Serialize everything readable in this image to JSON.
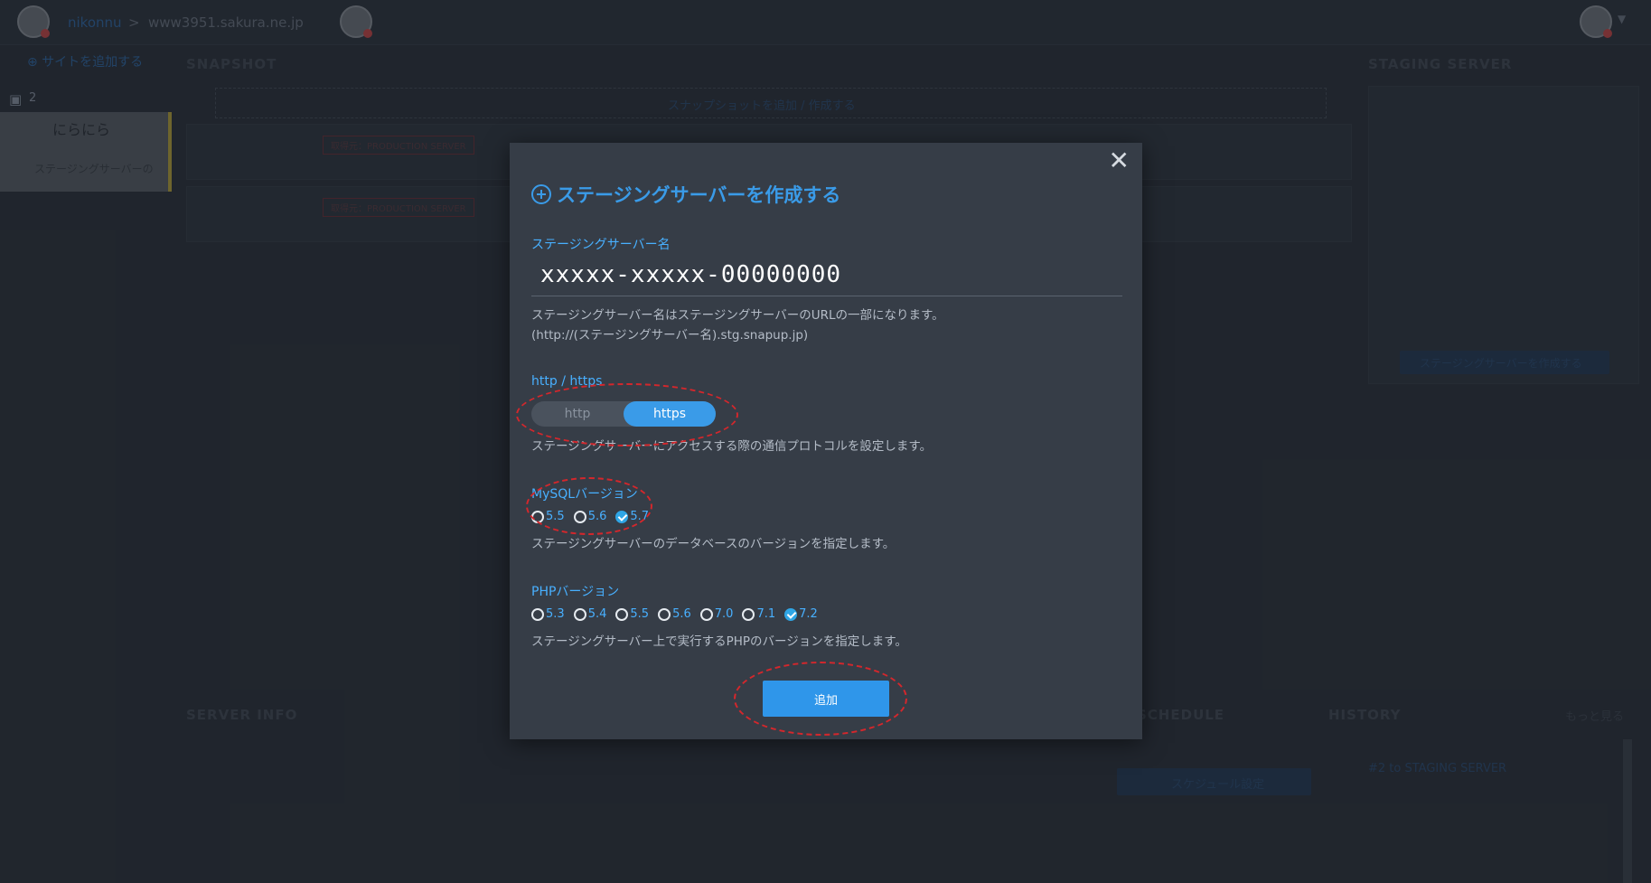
{
  "topbar": {
    "user_name": "nikonnu",
    "separator": ">",
    "server": "www3951.sakura.ne.jp"
  },
  "sidebar": {
    "add_site": "サイトを追加する",
    "site_card": {
      "count": "2",
      "name": "にらにら",
      "sub": "ステージングサーバーの"
    }
  },
  "sections": {
    "snapshot": "SNAPSHOT",
    "staging": "STAGING SERVER",
    "server_info": "SERVER INFO",
    "schedule": "SCHEDULE",
    "history": "HISTORY",
    "history_more": "もっと見る",
    "snapshot_add": "スナップショットを追加 / 作成する",
    "staging_create": "ステージングサーバーを作成する",
    "schedule_btn": "スケジュール設定",
    "production_tag": "取得元：PRODUCTION SERVER",
    "history_entry": "#2 to STAGING SERVER"
  },
  "modal": {
    "title": "ステージングサーバーを作成する",
    "close": "✕",
    "name_label": "ステージングサーバー名",
    "name_value": "xxxxx-xxxxx-00000000",
    "name_help_1": "ステージングサーバー名はステージングサーバーのURLの一部になります。",
    "name_help_2": "(http://(ステージングサーバー名).stg.snapup.jp)",
    "protocol_label": "http / https",
    "protocol_options": [
      "http",
      "https"
    ],
    "protocol_selected": "https",
    "protocol_help": "ステージングサーバーにアクセスする際の通信プロトコルを設定します。",
    "mysql_label": "MySQLバージョン",
    "mysql_options": [
      "5.5",
      "5.6",
      "5.7"
    ],
    "mysql_selected": "5.7",
    "mysql_help": "ステージングサーバーのデータベースのバージョンを指定します。",
    "php_label": "PHPバージョン",
    "php_options": [
      "5.3",
      "5.4",
      "5.5",
      "5.6",
      "7.0",
      "7.1",
      "7.2"
    ],
    "php_selected": "7.2",
    "php_help": "ステージングサーバー上で実行するPHPのバージョンを指定します。",
    "submit": "追加"
  },
  "colors": {
    "accent": "#3a9be8",
    "label": "#48b0ff",
    "modal_bg": "#363d47",
    "annotation": "#d3272c"
  }
}
